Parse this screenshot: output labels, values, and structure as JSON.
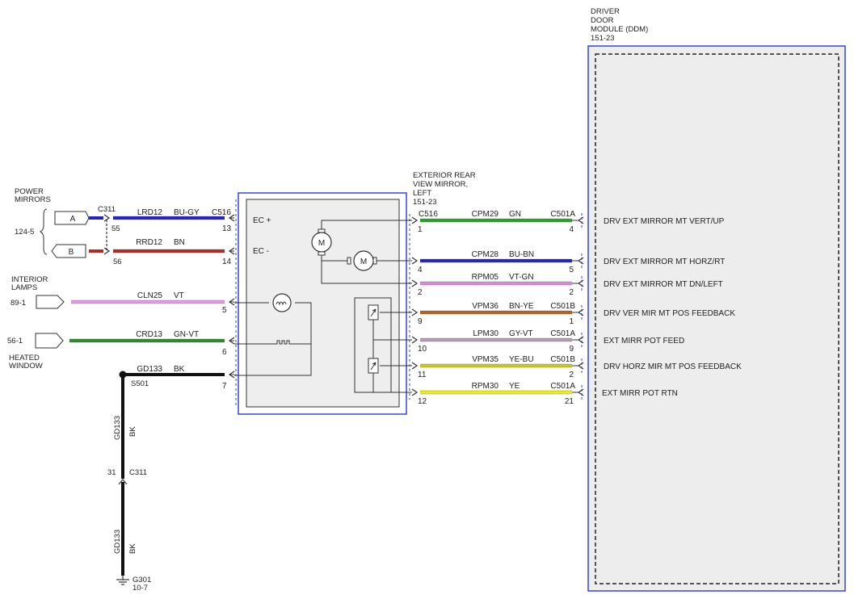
{
  "ddm": {
    "title_lines": [
      "DRIVER",
      "DOOR",
      "MODULE (DDM)",
      "151-23"
    ]
  },
  "mirror": {
    "title_lines": [
      "EXTERIOR REAR",
      "VIEW MIRROR,",
      "LEFT",
      "151-23"
    ],
    "ec_plus": "EC +",
    "ec_minus": "EC -",
    "motor_label": "M"
  },
  "left": {
    "power_mirrors_lines": [
      "POWER",
      "MIRRORS"
    ],
    "power_mirrors_ref": "124-5",
    "connector_a": "A",
    "connector_b": "B",
    "interior_lamps_lines": [
      "INTERIOR",
      "LAMPS"
    ],
    "interior_lamps_ref": "89-1",
    "heated_window_lines": [
      "HEATED",
      "WINDOW"
    ],
    "heated_window_ref": "56-1",
    "c311": "C311",
    "c311_pin_55": "55",
    "c311_pin_56": "56"
  },
  "wires_left": [
    {
      "circuit": "LRD12",
      "color_code": "BU-GY",
      "connector": "C516",
      "pin": "13",
      "color": "#2323c8"
    },
    {
      "circuit": "RRD12",
      "color_code": "BN",
      "connector": "",
      "pin": "14",
      "color": "#b52a24"
    },
    {
      "circuit": "CLN25",
      "color_code": "VT",
      "connector": "",
      "pin": "5",
      "color": "#e29ae2"
    },
    {
      "circuit": "CRD13",
      "color_code": "GN-VT",
      "connector": "",
      "pin": "6",
      "color": "#2e8a2e"
    },
    {
      "circuit": "GD133",
      "color_code": "BK",
      "connector": "",
      "pin": "7",
      "color": "#111111"
    }
  ],
  "wires_right": [
    {
      "circuit": "CPM29",
      "color_code": "GN",
      "left_connector": "C516",
      "right_connector": "C501A",
      "left_pin": "1",
      "right_pin": "4",
      "function": "DRV EXT MIRROR MT VERT/UP",
      "color": "#27a227"
    },
    {
      "circuit": "CPM28",
      "color_code": "BU-BN",
      "left_connector": "",
      "right_connector": "",
      "left_pin": "4",
      "right_pin": "5",
      "function": "DRV EXT MIRROR MT HORZ/RT",
      "color": "#2323c8"
    },
    {
      "circuit": "RPM05",
      "color_code": "VT-GN",
      "left_connector": "",
      "right_connector": "",
      "left_pin": "2",
      "right_pin": "2",
      "function": "DRV EXT MIRROR MT DN/LEFT",
      "color": "#d98ad9"
    },
    {
      "circuit": "VPM36",
      "color_code": "BN-YE",
      "left_connector": "",
      "right_connector": "C501B",
      "left_pin": "9",
      "right_pin": "1",
      "function": "DRV VER MIR MT POS FEEDBACK",
      "color": "#b8621e"
    },
    {
      "circuit": "LPM30",
      "color_code": "GY-VT",
      "left_connector": "",
      "right_connector": "C501A",
      "left_pin": "10",
      "right_pin": "9",
      "function": "EXT MIRR POT FEED",
      "color": "#b59ab5"
    },
    {
      "circuit": "VPM35",
      "color_code": "YE-BU",
      "left_connector": "",
      "right_connector": "C501B",
      "left_pin": "11",
      "right_pin": "2",
      "function": "DRV HORZ MIR MT POS FEEDBACK",
      "color": "#c8c81e"
    },
    {
      "circuit": "RPM30",
      "color_code": "YE",
      "left_connector": "",
      "right_connector": "C501A",
      "left_pin": "12",
      "right_pin": "21",
      "function": "EXT MIRR POT RTN",
      "color": "#eeee10"
    }
  ],
  "ground": {
    "splice": "S501",
    "circuit": "GD133",
    "color_code": "BK",
    "connector": "C311",
    "connector_pin": "31",
    "ground_point": "G301",
    "ground_ref": "10-7"
  }
}
